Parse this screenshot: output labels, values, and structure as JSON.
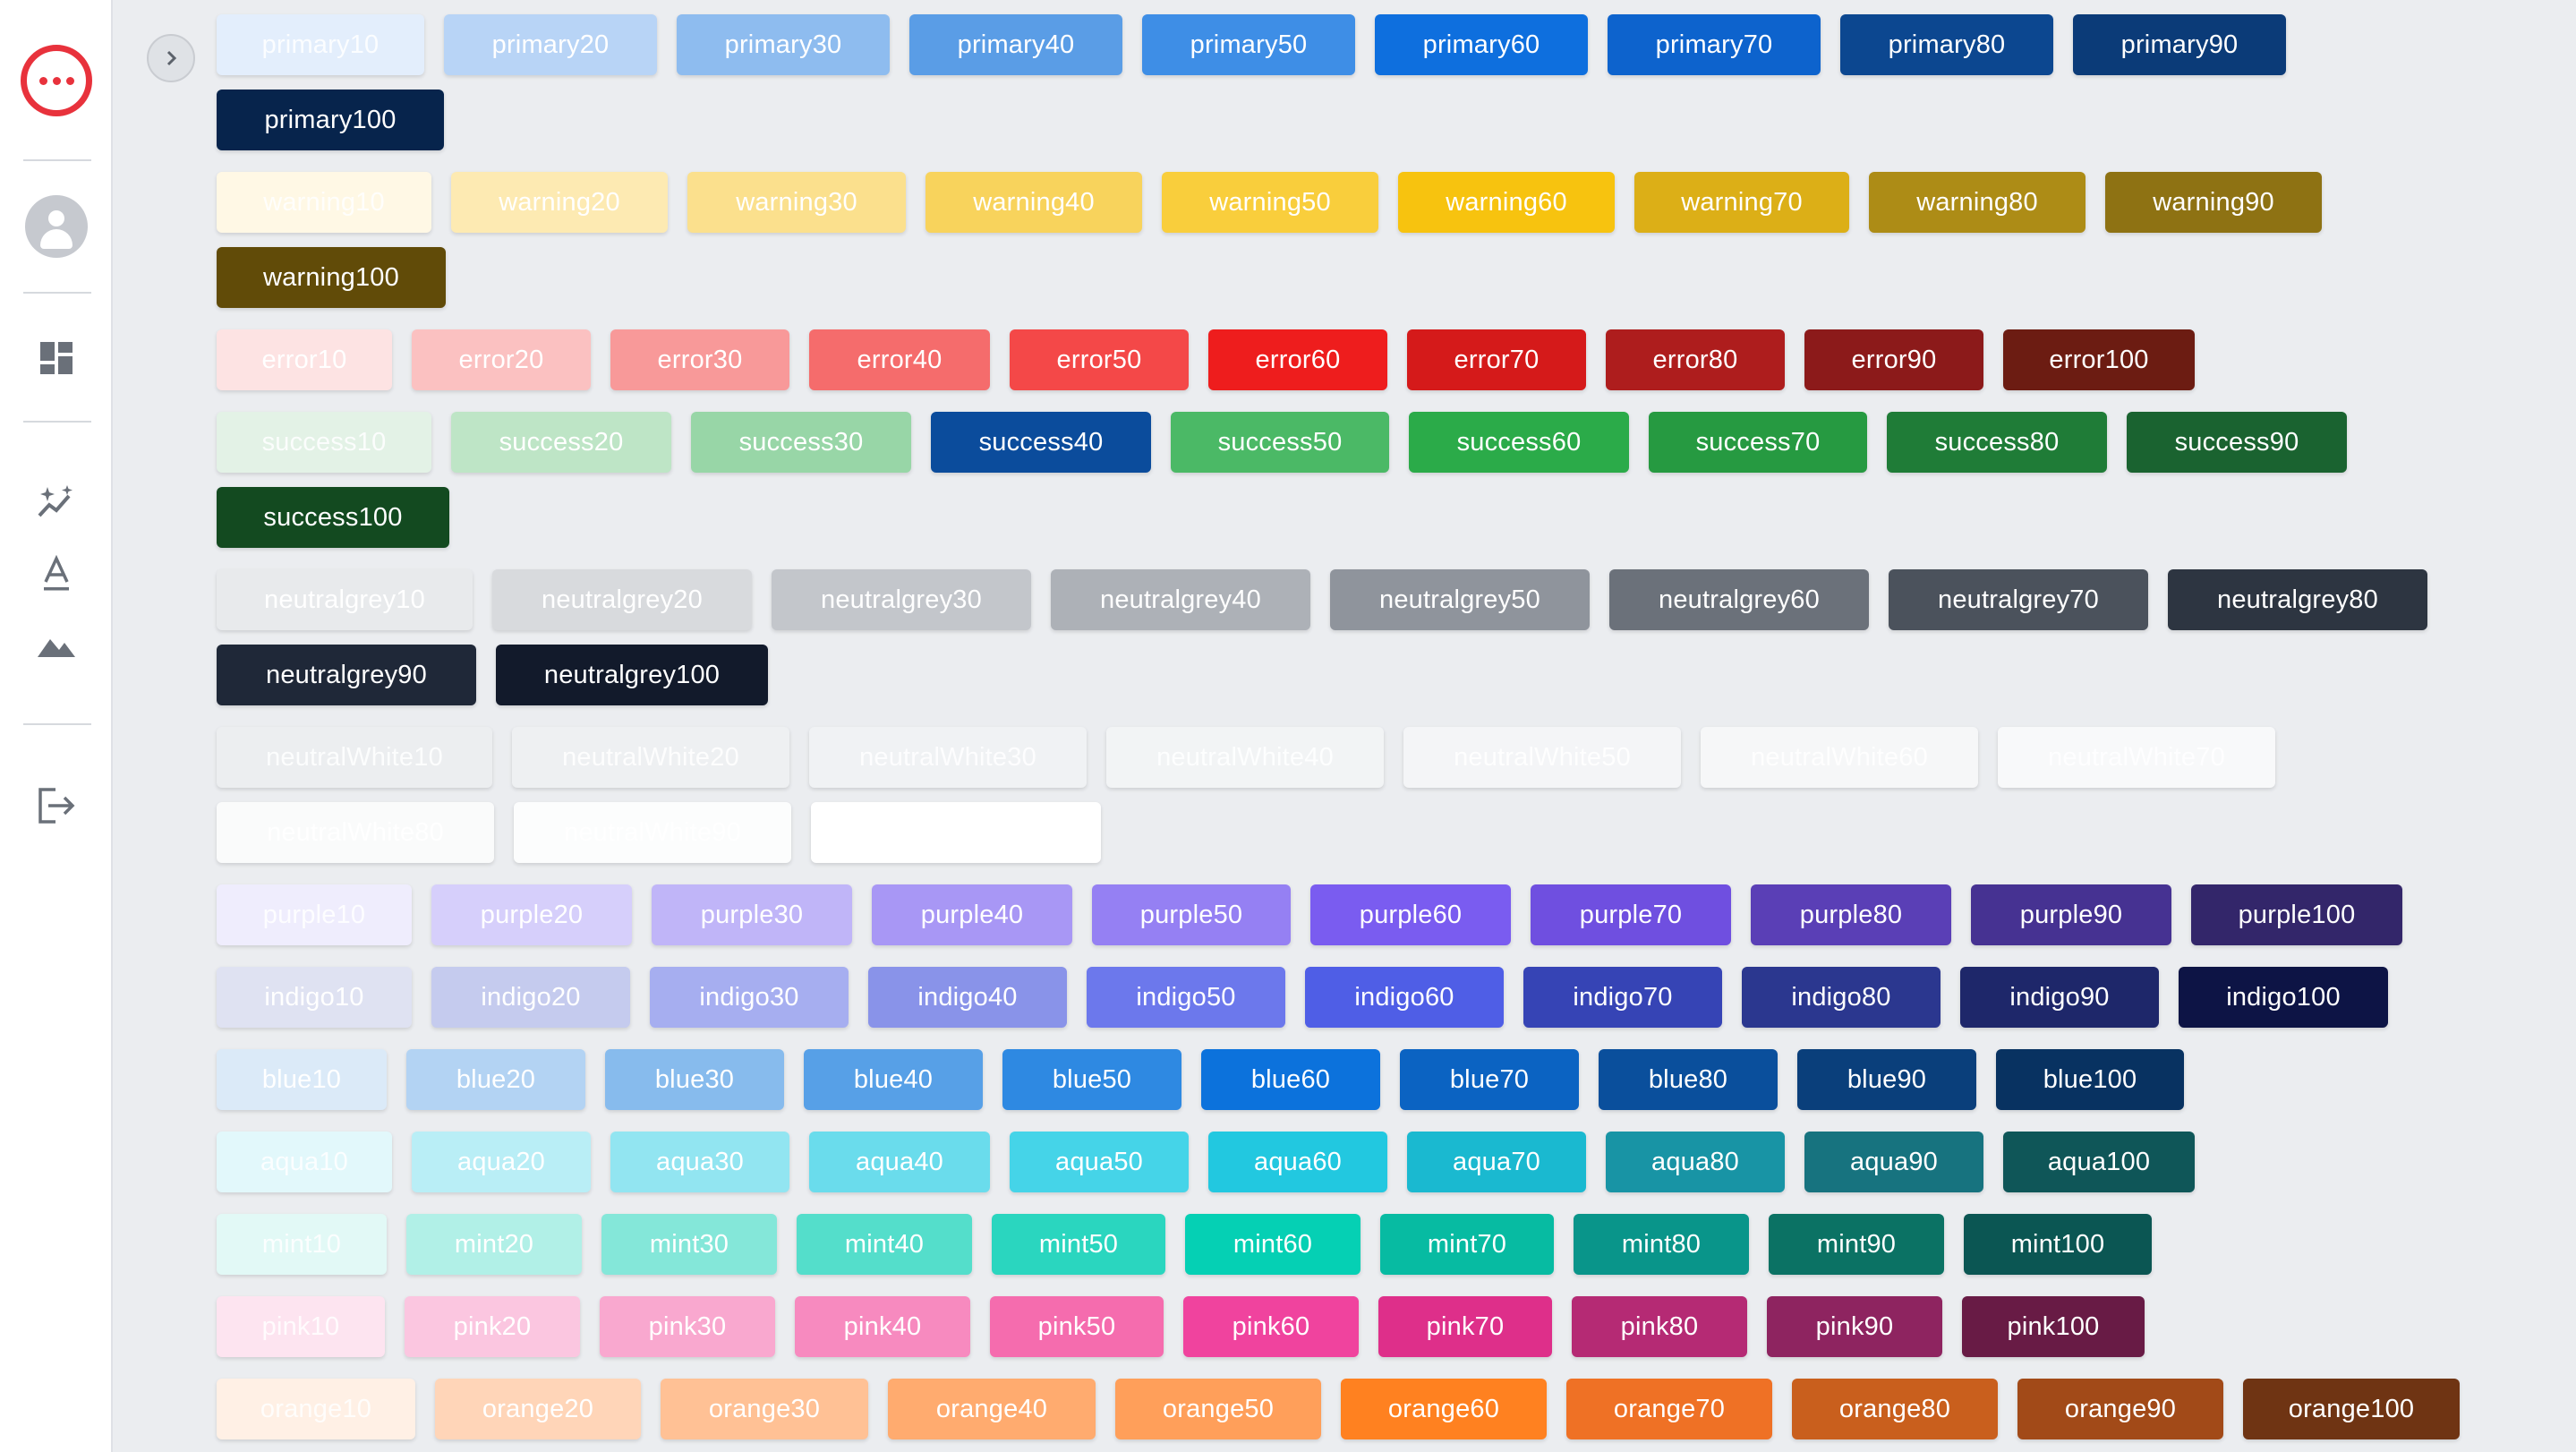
{
  "sidebar": {
    "icons": [
      "chat-logo",
      "user-avatar",
      "dashboard-icon",
      "sparkle-chart-icon",
      "text-format-icon",
      "image-icon",
      "logout-icon"
    ]
  },
  "toggle": {
    "icon": "chevron-right-icon"
  },
  "palettes": [
    {
      "name": "primary",
      "rows": [
        [
          {
            "label": "primary10",
            "color": "#e3eefc"
          },
          {
            "label": "primary20",
            "color": "#b8d4f6"
          },
          {
            "label": "primary30",
            "color": "#8ebcef"
          },
          {
            "label": "primary40",
            "color": "#5a9de6"
          },
          {
            "label": "primary50",
            "color": "#3e8ee6"
          },
          {
            "label": "primary60",
            "color": "#0e6fde"
          },
          {
            "label": "primary70",
            "color": "#0d63cd"
          },
          {
            "label": "primary80",
            "color": "#0c4790"
          },
          {
            "label": "primary90",
            "color": "#0b3b78"
          }
        ],
        [
          {
            "label": "primary100",
            "color": "#07244c"
          }
        ]
      ]
    },
    {
      "name": "warning",
      "rows": [
        [
          {
            "label": "warning10",
            "color": "#fff8e5"
          },
          {
            "label": "warning20",
            "color": "#fdeab2"
          },
          {
            "label": "warning30",
            "color": "#fbe08d"
          },
          {
            "label": "warning40",
            "color": "#f8d35c"
          },
          {
            "label": "warning50",
            "color": "#f9ce3c"
          },
          {
            "label": "warning60",
            "color": "#f7c30f"
          },
          {
            "label": "warning70",
            "color": "#dcaf17"
          },
          {
            "label": "warning80",
            "color": "#ad8c16"
          },
          {
            "label": "warning90",
            "color": "#8e7213"
          }
        ],
        [
          {
            "label": "warning100",
            "color": "#614b08"
          }
        ]
      ]
    },
    {
      "name": "error",
      "rows": [
        [
          {
            "label": "error10",
            "color": "#fde3e3"
          },
          {
            "label": "error20",
            "color": "#fbc1c1"
          },
          {
            "label": "error30",
            "color": "#f89999"
          },
          {
            "label": "error40",
            "color": "#f56c6c"
          },
          {
            "label": "error50",
            "color": "#f44848"
          },
          {
            "label": "error60",
            "color": "#ee1d1d"
          },
          {
            "label": "error70",
            "color": "#d51a1a"
          },
          {
            "label": "error80",
            "color": "#ae1d1d"
          },
          {
            "label": "error90",
            "color": "#8c1a1a"
          },
          {
            "label": "error100",
            "color": "#6c1c12"
          }
        ]
      ]
    },
    {
      "name": "success",
      "rows": [
        [
          {
            "label": "success10",
            "color": "#e3f2e6"
          },
          {
            "label": "success20",
            "color": "#bee5c6"
          },
          {
            "label": "success30",
            "color": "#98d6a7"
          },
          {
            "label": "success40",
            "color": "#0b4c9c"
          },
          {
            "label": "success50",
            "color": "#4bb966"
          },
          {
            "label": "success60",
            "color": "#2bab49"
          },
          {
            "label": "success70",
            "color": "#269a41"
          },
          {
            "label": "success80",
            "color": "#1f7c37"
          },
          {
            "label": "success90",
            "color": "#1a6330"
          }
        ],
        [
          {
            "label": "success100",
            "color": "#134a20"
          }
        ]
      ]
    },
    {
      "name": "neutralgrey",
      "rows": [
        [
          {
            "label": "neutralgrey10",
            "color": "#e8eaec"
          },
          {
            "label": "neutralgrey20",
            "color": "#d8dadd"
          },
          {
            "label": "neutralgrey30",
            "color": "#c3c6cb"
          },
          {
            "label": "neutralgrey40",
            "color": "#adb1b7"
          },
          {
            "label": "neutralgrey50",
            "color": "#8f949c"
          },
          {
            "label": "neutralgrey60",
            "color": "#6b717a"
          },
          {
            "label": "neutralgrey70",
            "color": "#4b525c"
          },
          {
            "label": "neutralgrey80",
            "color": "#2d3541"
          }
        ],
        [
          {
            "label": "neutralgrey90",
            "color": "#1f2838"
          },
          {
            "label": "neutralgrey100",
            "color": "#121a2b"
          }
        ]
      ]
    },
    {
      "name": "neutralWhite",
      "rows": [
        [
          {
            "label": "neutralWhite10",
            "color": "#eceef0"
          },
          {
            "label": "neutralWhite20",
            "color": "#eef0f2"
          },
          {
            "label": "neutralWhite30",
            "color": "#f0f2f4"
          },
          {
            "label": "neutralWhite40",
            "color": "#f2f4f5"
          },
          {
            "label": "neutralWhite50",
            "color": "#f4f5f7"
          },
          {
            "label": "neutralWhite60",
            "color": "#f6f7f8"
          },
          {
            "label": "neutralWhite70",
            "color": "#f8f9fa"
          }
        ],
        [
          {
            "label": "neutralWhite80",
            "color": "#fafbfb"
          },
          {
            "label": "neutralWhite90",
            "color": "#fcfdfd"
          },
          {
            "label": "neutralWhite100",
            "color": "#ffffff"
          }
        ]
      ]
    },
    {
      "name": "purple",
      "rows": [
        [
          {
            "label": "purple10",
            "color": "#efedfd"
          },
          {
            "label": "purple20",
            "color": "#d6cffb"
          },
          {
            "label": "purple30",
            "color": "#c0b5f8"
          },
          {
            "label": "purple40",
            "color": "#a897f5"
          },
          {
            "label": "purple50",
            "color": "#9580f3"
          },
          {
            "label": "purple60",
            "color": "#7a5cf0"
          },
          {
            "label": "purple70",
            "color": "#6f4fe0"
          },
          {
            "label": "purple80",
            "color": "#5a3fb6"
          },
          {
            "label": "purple90",
            "color": "#463292"
          },
          {
            "label": "purple100",
            "color": "#33266a"
          }
        ]
      ]
    },
    {
      "name": "indigo",
      "rows": [
        [
          {
            "label": "indigo10",
            "color": "#dfe2f2"
          },
          {
            "label": "indigo20",
            "color": "#c5cbee"
          },
          {
            "label": "indigo30",
            "color": "#a6aef0"
          },
          {
            "label": "indigo40",
            "color": "#8993e9"
          },
          {
            "label": "indigo50",
            "color": "#6c78ec"
          },
          {
            "label": "indigo60",
            "color": "#4f5ee6"
          },
          {
            "label": "indigo70",
            "color": "#3644b5"
          },
          {
            "label": "indigo80",
            "color": "#2b378f"
          },
          {
            "label": "indigo90",
            "color": "#1e276a"
          },
          {
            "label": "indigo100",
            "color": "#0d1445"
          }
        ]
      ]
    },
    {
      "name": "blue",
      "rows": [
        [
          {
            "label": "blue10",
            "color": "#dbeaf8"
          },
          {
            "label": "blue20",
            "color": "#b3d3f3"
          },
          {
            "label": "blue30",
            "color": "#87bbed"
          },
          {
            "label": "blue40",
            "color": "#57a0e7"
          },
          {
            "label": "blue50",
            "color": "#2e89e2"
          },
          {
            "label": "blue60",
            "color": "#0c72dc"
          },
          {
            "label": "blue70",
            "color": "#0b63c2"
          },
          {
            "label": "blue80",
            "color": "#0a4f9c"
          },
          {
            "label": "blue90",
            "color": "#0a3f7b"
          },
          {
            "label": "blue100",
            "color": "#083261"
          }
        ]
      ]
    },
    {
      "name": "aqua",
      "rows": [
        [
          {
            "label": "aqua10",
            "color": "#e2f8fb"
          },
          {
            "label": "aqua20",
            "color": "#b9eef6"
          },
          {
            "label": "aqua30",
            "color": "#92e5f1"
          },
          {
            "label": "aqua40",
            "color": "#6adcec"
          },
          {
            "label": "aqua50",
            "color": "#45d4e8"
          },
          {
            "label": "aqua60",
            "color": "#22c8e0"
          },
          {
            "label": "aqua70",
            "color": "#1ab9d0"
          },
          {
            "label": "aqua80",
            "color": "#1894a5"
          },
          {
            "label": "aqua90",
            "color": "#17737f"
          },
          {
            "label": "aqua100",
            "color": "#0f5658"
          }
        ]
      ]
    },
    {
      "name": "mint",
      "rows": [
        [
          {
            "label": "mint10",
            "color": "#e2f9f6"
          },
          {
            "label": "mint20",
            "color": "#b1f0e7"
          },
          {
            "label": "mint30",
            "color": "#84e7d9"
          },
          {
            "label": "mint40",
            "color": "#54decb"
          },
          {
            "label": "mint50",
            "color": "#2ad6bf"
          },
          {
            "label": "mint60",
            "color": "#05d0b4"
          },
          {
            "label": "mint70",
            "color": "#07bba2"
          },
          {
            "label": "mint80",
            "color": "#09958a"
          },
          {
            "label": "mint90",
            "color": "#0b7264"
          },
          {
            "label": "mint100",
            "color": "#0b5653"
          }
        ]
      ]
    },
    {
      "name": "pink",
      "rows": [
        [
          {
            "label": "pink10",
            "color": "#fde4f0"
          },
          {
            "label": "pink20",
            "color": "#fbc6e0"
          },
          {
            "label": "pink30",
            "color": "#f9a8cf"
          },
          {
            "label": "pink40",
            "color": "#f78abf"
          },
          {
            "label": "pink50",
            "color": "#f56cae"
          },
          {
            "label": "pink60",
            "color": "#f0439e"
          },
          {
            "label": "pink70",
            "color": "#de2f8a"
          },
          {
            "label": "pink80",
            "color": "#b52a74"
          },
          {
            "label": "pink90",
            "color": "#8e2460"
          },
          {
            "label": "pink100",
            "color": "#681b45"
          }
        ]
      ]
    },
    {
      "name": "orange",
      "rows": [
        [
          {
            "label": "orange10",
            "color": "#fff0e5"
          },
          {
            "label": "orange20",
            "color": "#ffd5b8"
          },
          {
            "label": "orange30",
            "color": "#ffc195"
          },
          {
            "label": "orange40",
            "color": "#ffab6f"
          },
          {
            "label": "orange50",
            "color": "#ff9f5a"
          },
          {
            "label": "orange60",
            "color": "#ff8120"
          },
          {
            "label": "orange70",
            "color": "#ef7125"
          },
          {
            "label": "orange80",
            "color": "#c95f1d"
          },
          {
            "label": "orange90",
            "color": "#a24a18"
          },
          {
            "label": "orange100",
            "color": "#6f3413"
          }
        ]
      ]
    }
  ]
}
